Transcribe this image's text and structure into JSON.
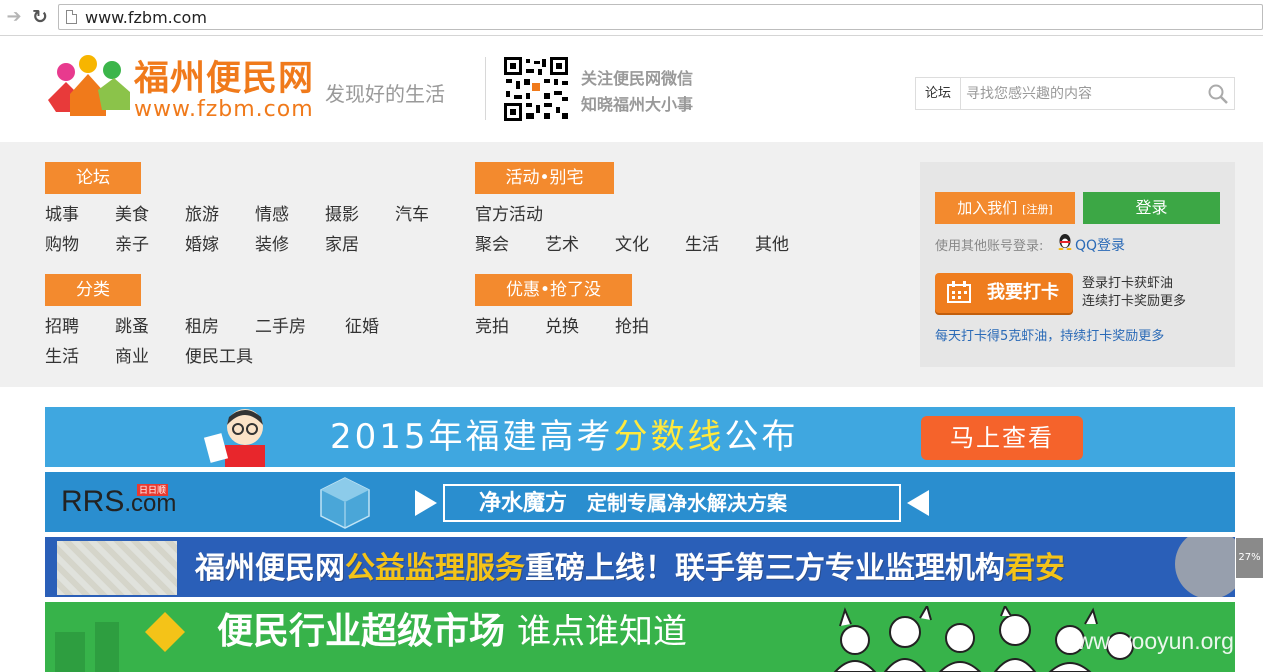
{
  "browser": {
    "url": "www.fzbm.com"
  },
  "header": {
    "logo_title": "福州便民网",
    "logo_url": "www.fzbm.com",
    "tagline": "发现好的生活",
    "wechat_line1": "关注便民网微信",
    "wechat_line2": "知晓福州大小事",
    "search_category": "论坛",
    "search_placeholder": "寻找您感兴趣的内容"
  },
  "nav": {
    "forum": {
      "heading": "论坛",
      "row1": [
        "城事",
        "美食",
        "旅游",
        "情感",
        "摄影",
        "汽车"
      ],
      "row2": [
        "购物",
        "亲子",
        "婚嫁",
        "装修",
        "家居"
      ]
    },
    "activity": {
      "heading": "活动•别宅",
      "row1": [
        "官方活动"
      ],
      "row2": [
        "聚会",
        "艺术",
        "文化",
        "生活",
        "其他"
      ]
    },
    "category": {
      "heading": "分类",
      "row1": [
        "招聘",
        "跳蚤",
        "租房",
        "二手房",
        "征婚"
      ],
      "row2": [
        "生活",
        "商业",
        "便民工具"
      ]
    },
    "deals": {
      "heading": "优惠•抢了没",
      "row1": [
        "竞拍",
        "兑换",
        "抢拍"
      ]
    }
  },
  "login": {
    "join_label": "加入我们",
    "register_label": "[注册]",
    "login_label": "登录",
    "other_login": "使用其他账号登录:",
    "qq_login": "QQ登录",
    "checkin_label": "我要打卡",
    "checkin_desc1": "登录打卡获虾油",
    "checkin_desc2": "连续打卡奖励更多",
    "checkin_note": "每天打卡得5克虾油，持续打卡奖励更多"
  },
  "banners": {
    "b1": {
      "text_pre": "2015年福建",
      "text_mid": "高考",
      "text_hl": "分数线",
      "text_post": "公布",
      "button": "马上查看"
    },
    "b2": {
      "logo": "RRS",
      "logo_com": ".com",
      "logo_tag": "日日顺",
      "title": "净水魔方",
      "subtitle": "定制专属净水解决方案"
    },
    "b3": {
      "text_pre": "福州便民网",
      "text_hl1": "公益监理服务",
      "text_mid": "重磅上线！联手第三方专业监理机构",
      "text_hl2": "君安"
    },
    "b4": {
      "title": "便民行业超级市场",
      "subtitle": "谁点谁知道"
    }
  },
  "side_widget": "27%",
  "watermark": "www.wooyun.org",
  "colors": {
    "brand_orange": "#f07a1b",
    "nav_heading": "#f38a2e",
    "login_green": "#3ca745",
    "link_blue": "#2a6ab7"
  }
}
